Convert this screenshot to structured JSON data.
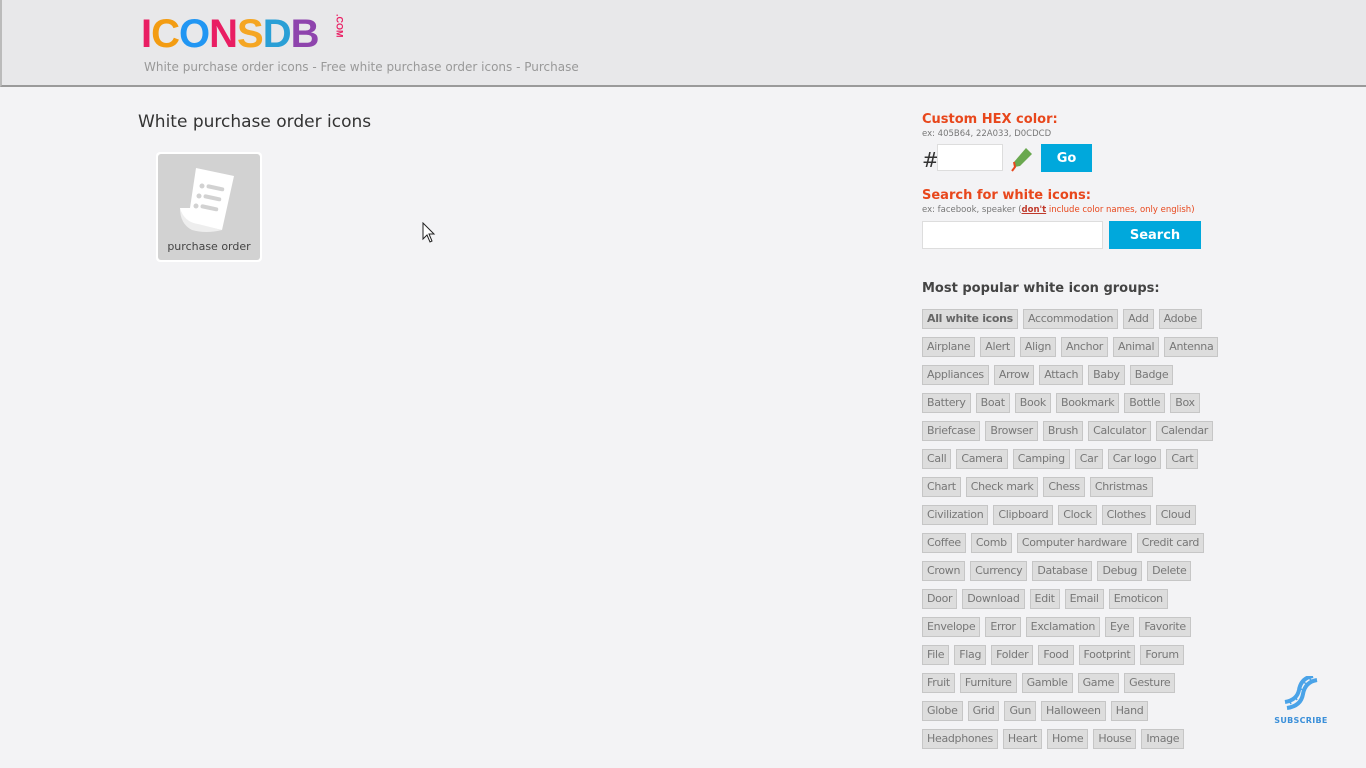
{
  "header": {
    "logo": "ICONSDB",
    "logo_suffix": ".COM",
    "subtitle": "White purchase order icons - Free white purchase order icons - Purchase"
  },
  "main": {
    "title": "White purchase order icons",
    "icons": [
      {
        "label": "purchase order",
        "icon": "purchase-order-icon"
      }
    ]
  },
  "sidebar": {
    "hex": {
      "heading": "Custom HEX color:",
      "example": "ex: 405B64, 22A033, D0CDCD",
      "hash": "#",
      "value": "",
      "go_label": "Go"
    },
    "search": {
      "heading": "Search for white icons:",
      "example_prefix": "ex: facebook, speaker (",
      "example_dont": "don't",
      "example_suffix": " include color names, only english)",
      "value": "",
      "button_label": "Search"
    },
    "groups_heading": "Most popular white icon groups:",
    "groups": [
      [
        "All white icons",
        "Accommodation",
        "Add",
        "Adobe"
      ],
      [
        "Airplane",
        "Alert",
        "Align",
        "Anchor",
        "Animal",
        "Antenna"
      ],
      [
        "Appliances",
        "Arrow",
        "Attach",
        "Baby",
        "Badge"
      ],
      [
        "Battery",
        "Boat",
        "Book",
        "Bookmark",
        "Bottle",
        "Box"
      ],
      [
        "Briefcase",
        "Browser",
        "Brush",
        "Calculator",
        "Calendar"
      ],
      [
        "Call",
        "Camera",
        "Camping",
        "Car",
        "Car logo",
        "Cart"
      ],
      [
        "Chart",
        "Check mark",
        "Chess",
        "Christmas"
      ],
      [
        "Civilization",
        "Clipboard",
        "Clock",
        "Clothes",
        "Cloud"
      ],
      [
        "Coffee",
        "Comb",
        "Computer hardware",
        "Credit card"
      ],
      [
        "Crown",
        "Currency",
        "Database",
        "Debug",
        "Delete"
      ],
      [
        "Door",
        "Download",
        "Edit",
        "Email",
        "Emoticon"
      ],
      [
        "Envelope",
        "Error",
        "Exclamation",
        "Eye",
        "Favorite"
      ],
      [
        "File",
        "Flag",
        "Folder",
        "Food",
        "Footprint",
        "Forum"
      ],
      [
        "Fruit",
        "Furniture",
        "Gamble",
        "Game",
        "Gesture"
      ],
      [
        "Globe",
        "Grid",
        "Gun",
        "Halloween",
        "Hand"
      ],
      [
        "Headphones",
        "Heart",
        "Home",
        "House",
        "Image"
      ]
    ]
  },
  "subscribe": {
    "label": "SUBSCRIBE",
    "icon": "dna-icon"
  },
  "colors": {
    "accent": "#00a8dc",
    "heading": "#e8471c",
    "tag_bg": "#dddddd"
  }
}
